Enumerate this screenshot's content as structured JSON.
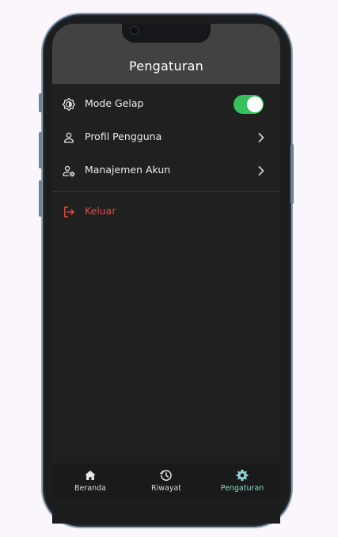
{
  "header": {
    "title": "Pengaturan"
  },
  "settings": {
    "dark_mode": {
      "label": "Mode Gelap",
      "enabled": true
    },
    "profile": {
      "label": "Profil Pengguna"
    },
    "account": {
      "label": "Manajemen Akun"
    },
    "logout": {
      "label": "Keluar"
    }
  },
  "bottom_nav": {
    "items": [
      {
        "label": "Beranda",
        "icon": "home-icon",
        "active": false
      },
      {
        "label": "Riwayat",
        "icon": "history-icon",
        "active": false
      },
      {
        "label": "Pengaturan",
        "icon": "gear-icon",
        "active": true
      }
    ]
  },
  "colors": {
    "accent": "#8fd3cf",
    "toggle_on": "#35c25d",
    "danger": "#e04b3f",
    "screen_bg": "#202020",
    "header_bg": "#424242"
  }
}
